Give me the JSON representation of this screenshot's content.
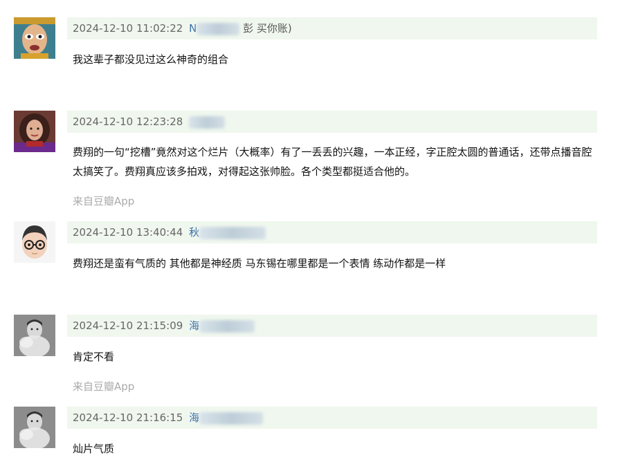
{
  "comments": [
    {
      "time": "2024-12-10 11:02:22",
      "user": "N",
      "user_tail": "彭     买你账)",
      "text": "我这辈子都没见过这么神奇的组合",
      "source": ""
    },
    {
      "time": "2024-12-10 12:23:28",
      "user": "",
      "user_tail": "",
      "text": "费翔的一句“挖槽”竟然对这个烂片（大概率）有了一丢丢的兴趣，一本正经，字正腔太圆的普通话，还带点播音腔太搞笑了。费翔真应该多拍戏，对得起这张帅脸。各个类型都挺适合他的。",
      "source": "来自豆瓣App"
    },
    {
      "time": "2024-12-10 13:40:44",
      "user": "秋",
      "user_tail": "",
      "text": "费翔还是蛮有气质的 其他都是神经质 马东锡在哪里都是一个表情 练动作都是一样",
      "source": ""
    },
    {
      "time": "2024-12-10 21:15:09",
      "user": "海",
      "user_tail": "",
      "text": "肯定不看",
      "source": "来自豆瓣App"
    },
    {
      "time": "2024-12-10 21:16:15",
      "user": "海",
      "user_tail": "",
      "text": "灿片气质",
      "source": ""
    }
  ]
}
